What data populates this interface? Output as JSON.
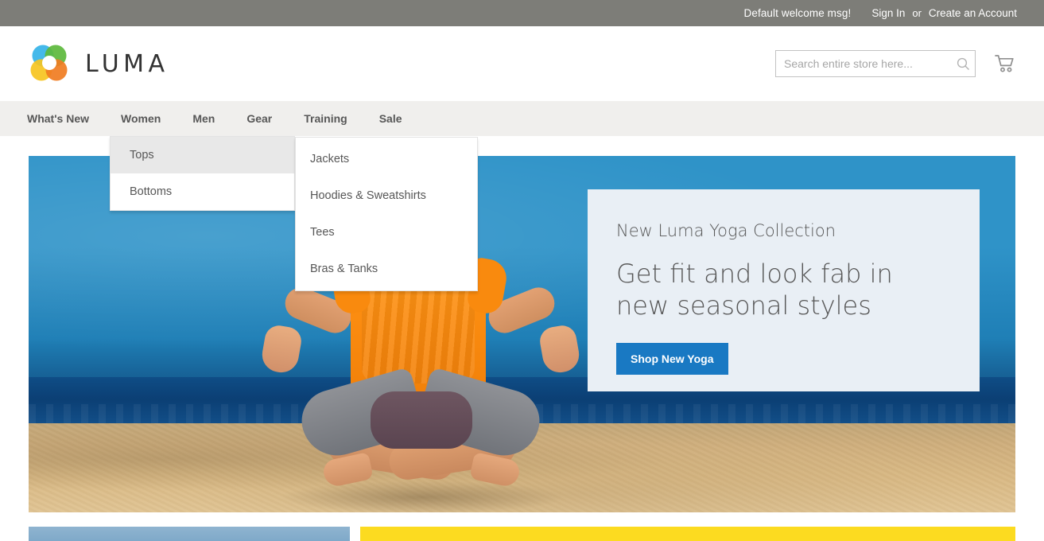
{
  "top_panel": {
    "welcome": "Default welcome msg!",
    "sign_in": "Sign In",
    "separator": "or",
    "create_account": "Create an Account"
  },
  "header": {
    "logo_text": "LUMA",
    "logo_icon": "luma-flower-logo",
    "search": {
      "placeholder": "Search entire store here...",
      "value": "",
      "icon": "search-icon"
    },
    "cart": {
      "icon": "shopping-cart-icon"
    }
  },
  "nav": {
    "items": [
      {
        "label": "What's New"
      },
      {
        "label": "Women"
      },
      {
        "label": "Men"
      },
      {
        "label": "Gear"
      },
      {
        "label": "Training"
      },
      {
        "label": "Sale"
      }
    ]
  },
  "dropdown_level1": {
    "items": [
      {
        "label": "Tops",
        "active": true
      },
      {
        "label": "Bottoms",
        "active": false
      }
    ]
  },
  "dropdown_level2": {
    "items": [
      {
        "label": "Jackets"
      },
      {
        "label": "Hoodies & Sweatshirts"
      },
      {
        "label": "Tees"
      },
      {
        "label": "Bras & Tanks"
      }
    ]
  },
  "hero": {
    "eyebrow": "New Luma Yoga Collection",
    "title": "Get fit and look fab in new seasonal styles",
    "cta_label": "Shop New Yoga",
    "image_alt": "woman-meditating-on-beach"
  },
  "bottom_promos": [
    {
      "name": "promo-block-left"
    },
    {
      "name": "promo-block-right"
    }
  ],
  "colors": {
    "top_panel_bg": "#7d7d78",
    "nav_bg": "#f0efed",
    "accent_blue": "#1979c3",
    "hero_panel_bg": "#e9eff5",
    "promo_yellow": "#fcdb20",
    "text_gray": "#575757"
  }
}
